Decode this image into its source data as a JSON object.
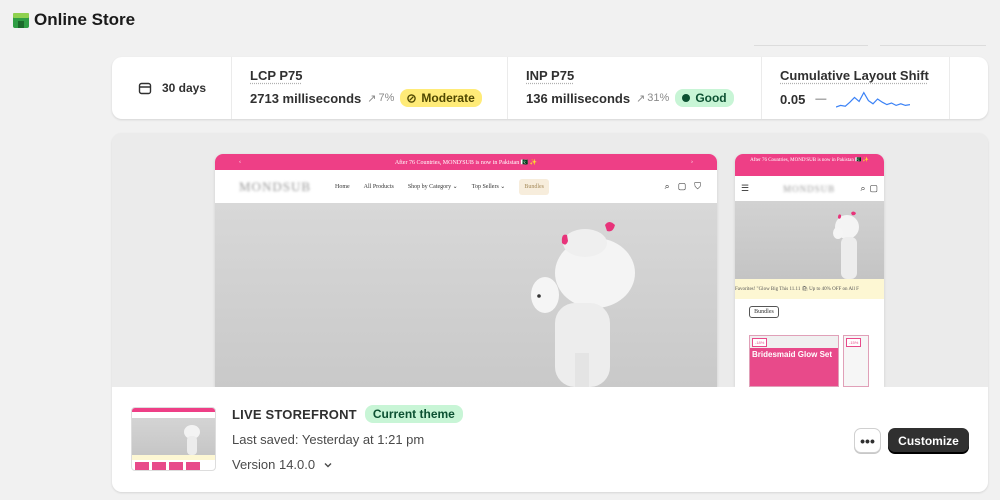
{
  "app": {
    "title": "Online Store",
    "icon": "store-icon"
  },
  "metrics": {
    "date_range": {
      "label": "30 days",
      "icon": "calendar-icon"
    },
    "lcp": {
      "label": "LCP P75",
      "value": "2713 milliseconds",
      "trend": "7%",
      "badge": "Moderate",
      "badge_icon": "gauge-icon"
    },
    "inp": {
      "label": "INP P75",
      "value": "136 milliseconds",
      "trend": "31%",
      "badge": "Good"
    },
    "cls": {
      "label": "Cumulative Layout Shift",
      "value": "0.05",
      "trend": "—",
      "sparkline": [
        0,
        0.1,
        0.05,
        0.3,
        0.6,
        0.35,
        0.9,
        0.4,
        0.2,
        0.5,
        0.3,
        0.15,
        0.25,
        0.1,
        0.2,
        0.1,
        0.15
      ],
      "sparkline_color": "#3b82f6"
    }
  },
  "preview": {
    "desktop": {
      "banner": "After 76 Countries, MOND'SUB is now in Pakistan 🇵🇰 ✨",
      "brand": "MONDSUB",
      "nav": [
        "Home",
        "All Products",
        "Shop by Category ⌄",
        "Top Sellers ⌄",
        "Bundles"
      ]
    },
    "mobile": {
      "banner": "After 76 Countries, MOND'SUB is now in Pakistan 🇵🇰 ✨",
      "brand": "MONDSUB",
      "ticker": "Favorites!   \"Glow Big This 11.11 🛍 Up to 40% OFF on All F",
      "bundles": "Bundles",
      "product_title": "Bridesmaid Glow Set",
      "discount": "-18%",
      "discount2": "-15%"
    },
    "accent_color": "#ee3f86"
  },
  "theme": {
    "title": "LIVE STOREFRONT",
    "badge": "Current theme",
    "saved": "Last saved: Yesterday at 1:21 pm",
    "version": "Version 14.0.0",
    "more_label": "•••",
    "customize_label": "Customize"
  }
}
